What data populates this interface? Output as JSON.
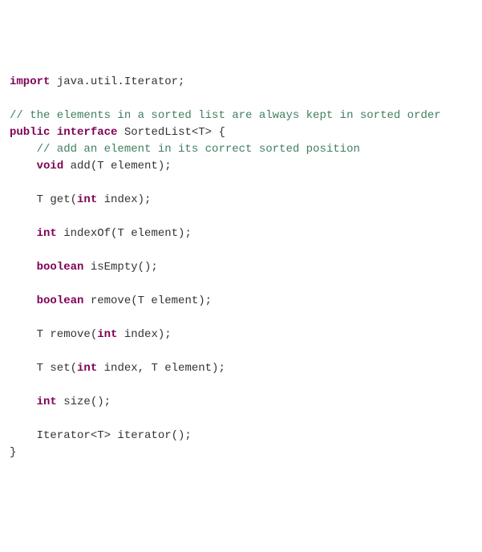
{
  "tokens": {
    "import": "import",
    "public": "public",
    "interface": "interface",
    "void": "void",
    "int": "int",
    "boolean": "boolean"
  },
  "pkg_import": " java.util.Iterator;",
  "comment_class": "// the elements in a sorted list are always kept in sorted order",
  "iface_name": " SortedList<T> {",
  "comment_add": "    // add an element in its correct sorted position",
  "m_add": " add(T element);",
  "m_get_pre": "    T get(",
  "m_get_post": " index);",
  "m_indexOf": " indexOf(T element);",
  "m_isEmpty": " isEmpty();",
  "m_remove_elem": " remove(T element);",
  "m_remove_idx_pre": "    T remove(",
  "m_remove_idx_post": " index);",
  "m_set_pre": "    T set(",
  "m_set_mid": " index, T element);",
  "m_size": " size();",
  "m_iterator": "    Iterator<T> iterator();",
  "close": "}",
  "sp4": "    "
}
